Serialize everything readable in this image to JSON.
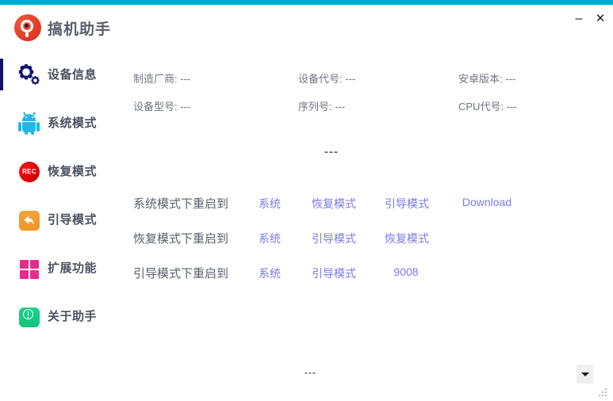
{
  "window": {
    "title": "搞机助手",
    "accent_color": "#00a8d5",
    "logo_icon": "app-logo-icon",
    "minimize_label": "–",
    "close_label": "✕"
  },
  "sidebar": {
    "active_index": 0,
    "items": [
      {
        "label": "设备信息",
        "icon": "gear-icon",
        "active": true
      },
      {
        "label": "系统模式",
        "icon": "android-robot-icon",
        "active": false
      },
      {
        "label": "恢复模式",
        "icon": "rec-icon",
        "active": false,
        "icon_text": "REC"
      },
      {
        "label": "引导模式",
        "icon": "back-arrow-icon",
        "active": false
      },
      {
        "label": "扩展功能",
        "icon": "grid-squares-icon",
        "active": false
      },
      {
        "label": "关于助手",
        "icon": "info-exclaim-icon",
        "active": false
      }
    ]
  },
  "device_info": {
    "placeholder": "---",
    "fields": [
      {
        "label": "制造厂商:",
        "value": "---"
      },
      {
        "label": "设备代号:",
        "value": "---"
      },
      {
        "label": "安卓版本:",
        "value": "---"
      },
      {
        "label": "设备型号:",
        "value": "---"
      },
      {
        "label": "序列号:",
        "value": "---"
      },
      {
        "label": "CPU代号:",
        "value": "---"
      }
    ]
  },
  "status_center": "---",
  "reboot_rows": [
    {
      "label": "系统模式下重启到",
      "links": [
        "系统",
        "恢复模式",
        "引导模式",
        "Download"
      ]
    },
    {
      "label": "恢复模式下重启到",
      "links": [
        "系统",
        "引导模式",
        "恢复模式"
      ]
    },
    {
      "label": "引导模式下重启到",
      "links": [
        "系统",
        "引导模式",
        "9008"
      ]
    }
  ],
  "footer": {
    "status": "---",
    "dropdown_icon": "chevron-down-icon",
    "resize_icon": "resize-grip-icon"
  },
  "colors": {
    "accent": "#00a8d5",
    "link": "#7b79ea",
    "active_marker": "#11116e",
    "text": "#5a5f6b"
  }
}
